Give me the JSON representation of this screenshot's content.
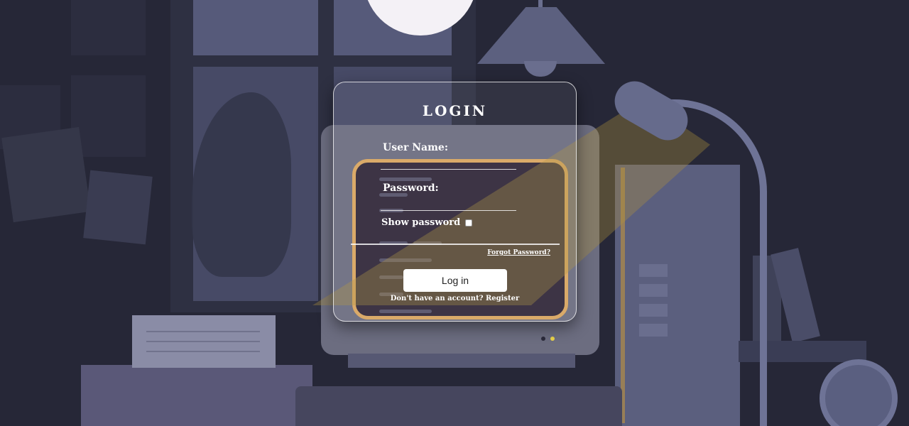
{
  "login": {
    "title": "LOGIN",
    "username_label": "User Name:",
    "username_value": "",
    "password_label": "Password:",
    "password_value": "",
    "show_password_label": "Show password",
    "show_password_checked": false,
    "forgot_password": "Forgot Password?",
    "login_button": "Log in",
    "register_prompt": "Don't have an account?",
    "register_link": "Register"
  },
  "colors": {
    "background": "#262737",
    "card_border": "#ffffff",
    "text": "#ffffff",
    "button_bg": "#ffffff",
    "lamp_light": "#d8a560"
  }
}
